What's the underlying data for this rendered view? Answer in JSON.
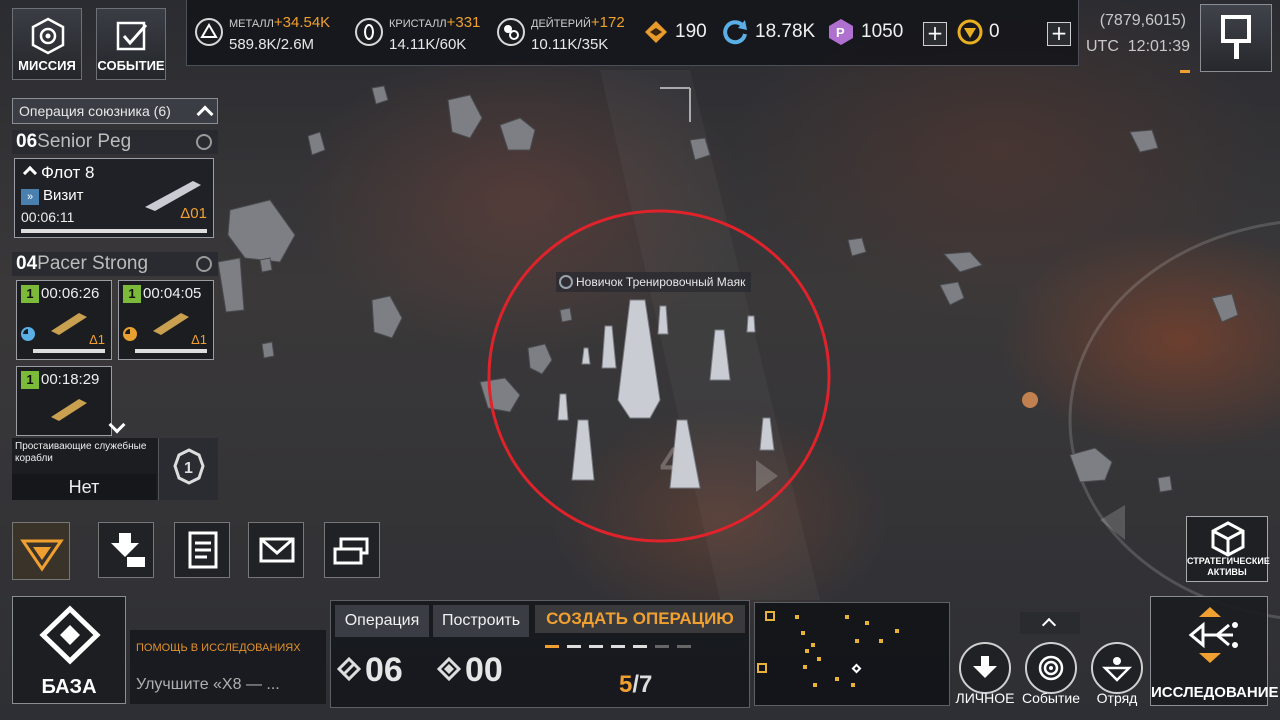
{
  "top": {
    "mission_label": "МИССИЯ",
    "event_label": "СОБЫТИЕ",
    "resources": [
      {
        "name": "МЕТАЛЛ",
        "income": "+34.54K",
        "amount": "589.8K/2.6M",
        "icon": "metal-icon"
      },
      {
        "name": "КРИСТАЛЛ",
        "income": "+331",
        "amount": "14.11K/60K",
        "icon": "crystal-icon"
      },
      {
        "name": "ДЕЙТЕРИЙ",
        "income": "+172",
        "amount": "10.11K/35K",
        "icon": "deuterium-icon"
      }
    ],
    "currencies": [
      {
        "value": "190",
        "icon": "energy-icon"
      },
      {
        "value": "18.78K",
        "icon": "cycle-icon"
      },
      {
        "value": "1050",
        "icon": "premium-currency-icon"
      },
      {
        "value": "0",
        "icon": "token-icon"
      }
    ],
    "coords": "(7879,6015)",
    "utc_label": "UTC",
    "time": "12:01:39"
  },
  "left": {
    "ally_ops_label": "Операция союзника (6)",
    "player1": {
      "rank": "06",
      "name": "Senior Peg"
    },
    "fleet": {
      "name": "Флот 8",
      "action": "Визит",
      "timer": "00:06:11",
      "level": "Δ01"
    },
    "player2": {
      "rank": "04",
      "name": "Pacer Strong"
    },
    "slots": [
      {
        "timer": "00:06:26",
        "level": "Δ1"
      },
      {
        "timer": "00:04:05",
        "level": "Δ1"
      },
      {
        "timer": "00:18:29",
        "level": ""
      }
    ],
    "idle_label": "Простаивающие служебные корабли",
    "idle_value": "Нет"
  },
  "map": {
    "beacon_label": "Новичок Тренировочный Маяк",
    "beacon_level": "4"
  },
  "bottom": {
    "base_label": "БАЗА",
    "help_title": "ПОМОЩЬ В ИССЛЕДОВАНИЯХ",
    "help_body": "Улучшите «X8 — ...",
    "op_tab": "Операция",
    "build_tab": "Построить",
    "op_count": "06",
    "build_count": "00",
    "create_label": "СОЗДАТЬ ОПЕРАЦИЮ",
    "progress_current": "5",
    "progress_total": "/7",
    "personal_label": "ЛИЧНОЕ",
    "event_label": "Событие",
    "squad_label": "Отряд",
    "research_label": "ИССЛЕДОВАНИЕ",
    "strategic_label_1": "СТРАТЕГИЧЕСКИЕ",
    "strategic_label_2": "АКТИВЫ"
  },
  "colors": {
    "accent": "#f0a030",
    "highlight_circle": "#e0222a",
    "badge_green": "#7cba3a",
    "premium": "#b070d0"
  }
}
